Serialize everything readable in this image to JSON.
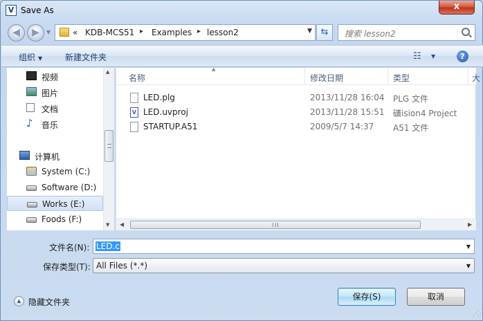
{
  "window": {
    "title": "Save As",
    "app_icon": "V",
    "close_label": "x"
  },
  "address_bar": {
    "prefix": "«",
    "crumbs": [
      "KDB-MCS51",
      "Examples",
      "lesson2"
    ],
    "separator": "▸"
  },
  "search": {
    "placeholder": "搜索 lesson2"
  },
  "toolbar": {
    "organize": "组织",
    "new_folder": "新建文件夹",
    "help": "?"
  },
  "nav": {
    "items": [
      {
        "label": "视频",
        "icon": "video-library-icon"
      },
      {
        "label": "图片",
        "icon": "pictures-library-icon"
      },
      {
        "label": "文档",
        "icon": "documents-library-icon"
      },
      {
        "label": "音乐",
        "icon": "music-library-icon"
      },
      {
        "label": "计算机",
        "icon": "computer-icon"
      },
      {
        "label": "System (C:)",
        "icon": "system-drive-icon"
      },
      {
        "label": "Software (D:)",
        "icon": "drive-icon"
      },
      {
        "label": "Works (E:)",
        "icon": "drive-icon",
        "selected": true
      },
      {
        "label": "Foods (F:)",
        "icon": "drive-icon"
      }
    ]
  },
  "file_list": {
    "columns": [
      "名称",
      "修改日期",
      "类型",
      "大"
    ],
    "rows": [
      {
        "name": "LED.plg",
        "modified": "2013/11/28 16:04",
        "type": "PLG 文件",
        "icon": "file-icon"
      },
      {
        "name": "LED.uvproj",
        "modified": "2013/11/28 15:51",
        "type": "礦ision4 Project",
        "icon": "uvision-project-icon"
      },
      {
        "name": "STARTUP.A51",
        "modified": "2009/5/7 14:37",
        "type": "A51 文件",
        "icon": "file-icon"
      }
    ]
  },
  "form": {
    "filename_label": "文件名(N):",
    "filename_value": "LED.c",
    "filetype_label": "保存类型(T):",
    "filetype_value": "All Files (*.*)"
  },
  "footer": {
    "hide_folders": "隐藏文件夹",
    "save": "保存(S)",
    "cancel": "取消"
  }
}
